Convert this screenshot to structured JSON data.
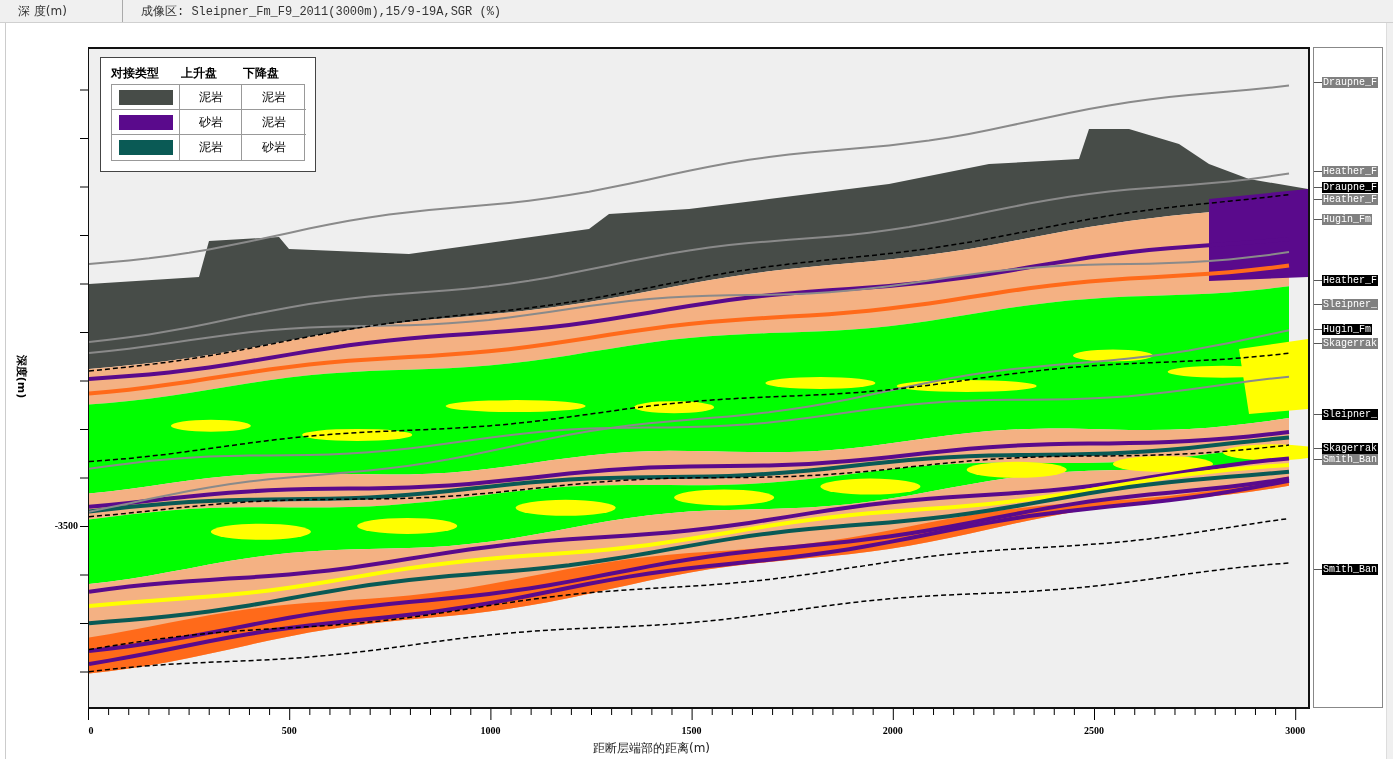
{
  "header": {
    "depth_label": "深 度(m)",
    "title": "成像区: Sleipner_Fm_F9_2011(3000m),15/9-19A,SGR (%)"
  },
  "legend": {
    "columns": [
      "对接类型",
      "上升盘",
      "下降盘"
    ],
    "rows": [
      {
        "color": "#474c48",
        "upthrown": "泥岩",
        "downthrown": "泥岩"
      },
      {
        "color": "#5a0a8c",
        "upthrown": "砂岩",
        "downthrown": "泥岩"
      },
      {
        "color": "#0a5a55",
        "upthrown": "泥岩",
        "downthrown": "砂岩"
      }
    ]
  },
  "y_axis": {
    "title": "深度(m)",
    "tick_labels": [
      "-3500"
    ]
  },
  "x_axis": {
    "title": "距断层端部的距离(m)",
    "tick_labels": [
      "0",
      "500",
      "1000",
      "1500",
      "2000",
      "2500",
      "3000"
    ]
  },
  "formation_tops": [
    {
      "label": "Draupne_F",
      "highlighted": false
    },
    {
      "label": "Heather_F",
      "highlighted": false
    },
    {
      "label": "Draupne_F",
      "highlighted": true
    },
    {
      "label": "Heather_F",
      "highlighted": false
    },
    {
      "label": "Hugin_Fm",
      "highlighted": false
    },
    {
      "label": "Heather_F",
      "highlighted": true
    },
    {
      "label": "Sleipner_",
      "highlighted": false
    },
    {
      "label": "Hugin_Fm",
      "highlighted": true
    },
    {
      "label": "Skagerrak",
      "highlighted": false
    },
    {
      "label": "Sleipner_",
      "highlighted": true
    },
    {
      "label": "Skagerrak",
      "highlighted": true
    },
    {
      "label": "Smith_Ban",
      "highlighted": false
    },
    {
      "label": "Smith_Ban",
      "highlighted": true
    }
  ]
}
